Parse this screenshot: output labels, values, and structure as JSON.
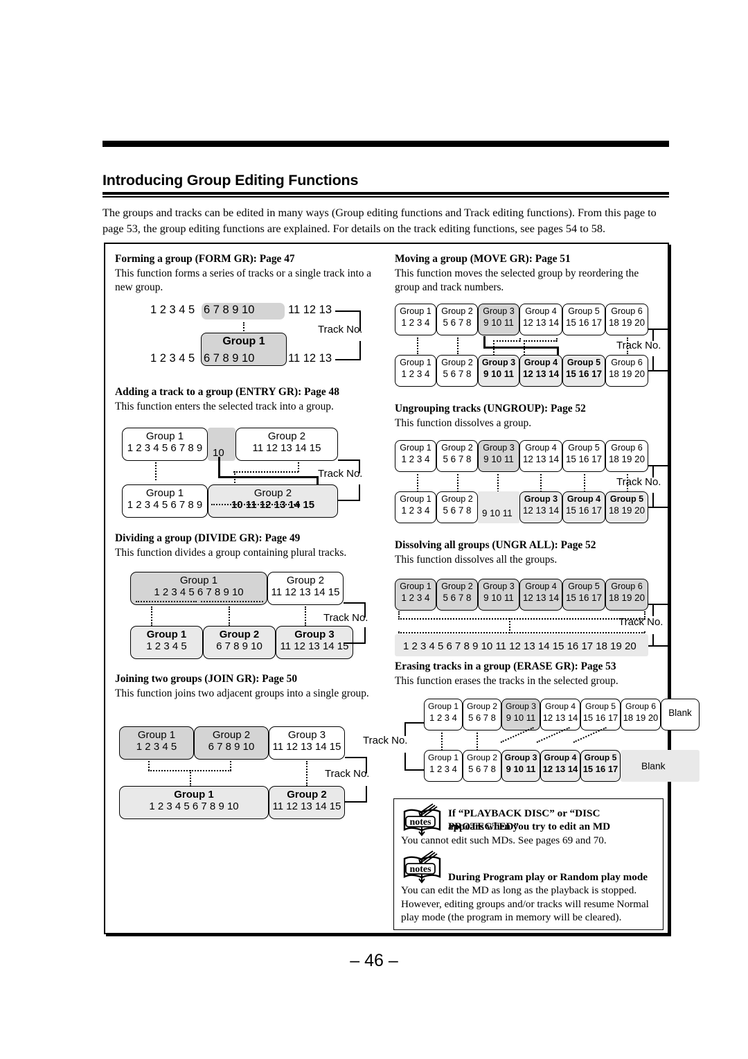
{
  "header": {
    "title": "Introducing Group Editing Functions",
    "intro": "The groups and tracks can be edited in many ways (Group editing functions and Track editing functions). From this page to page 53, the group editing functions are explained. For details on the track editing functions, see pages 54 to 58."
  },
  "labels": {
    "track_no": "Track No.",
    "blank": "Blank"
  },
  "sections": {
    "form": {
      "title": "Forming a group (FORM GR): Page 47",
      "body": "This function forms a series of tracks or a single track into a new group.",
      "before_prefix": "1 2 3 4 5",
      "before_selected": "6 7 8 9 10",
      "before_suffix": "11 12 13",
      "group_label": "Group 1",
      "after_prefix": "1 2 3 4 5",
      "after_group": "6 7 8 9 10",
      "after_suffix": "11 12 13"
    },
    "entry": {
      "title": "Adding a track to a group (ENTRY GR): Page 48",
      "body": "This function enters the selected track into a group.",
      "top": {
        "g1_name": "Group 1",
        "g1_nums": "1 2 3 4 5 6 7 8 9",
        "loose": "10",
        "g2_name": "Group 2",
        "g2_nums": "11  12  13  14  15"
      },
      "bottom": {
        "g1_name": "Group 1",
        "g1_nums": "1 2 3 4 5 6 7 8 9",
        "g2_name": "Group 2",
        "g2_nums": "10  11  12  13  14  15"
      }
    },
    "divide": {
      "title": "Dividing a group (DIVIDE GR): Page 49",
      "body": "This function divides a group containing plural tracks.",
      "top": {
        "g1_name": "Group 1",
        "g1_nums": "1  2  3  4  5  6  7  8  9  10",
        "g2_name": "Group 2",
        "g2_nums": "11 12 13 14 15"
      },
      "bottom": [
        {
          "name": "Group 1",
          "nums": "1  2  3  4  5"
        },
        {
          "name": "Group 2",
          "nums": "6  7  8  9  10"
        },
        {
          "name": "Group 3",
          "nums": "11 12 13 14 15"
        }
      ]
    },
    "join": {
      "title": "Joining two groups (JOIN GR): Page 50",
      "body": "This function joins two adjacent groups into a single group.",
      "top": [
        {
          "name": "Group 1",
          "nums": "1 2 3 4 5"
        },
        {
          "name": "Group 2",
          "nums": "6 7 8 9 10"
        },
        {
          "name": "Group 3",
          "nums": "11 12 13 14 15"
        }
      ],
      "bottom": [
        {
          "name": "Group 1",
          "nums": "1 2 3 4 5 6 7 8 9 10"
        },
        {
          "name": "Group 2",
          "nums": "11 12 13 14 15"
        }
      ]
    },
    "move": {
      "title": "Moving a group (MOVE GR): Page 51",
      "body": "This function moves the selected group by reordering the group and track numbers.",
      "top": [
        {
          "name": "Group 1",
          "nums": "1 2 3 4"
        },
        {
          "name": "Group 2",
          "nums": "5 6 7 8"
        },
        {
          "name": "Group 3",
          "nums": "9 10 11"
        },
        {
          "name": "Group 4",
          "nums": "12 13 14"
        },
        {
          "name": "Group 5",
          "nums": "15 16 17"
        },
        {
          "name": "Group 6",
          "nums": "18 19 20"
        }
      ],
      "bottom": [
        {
          "name": "Group 1",
          "nums": "1 2 3 4"
        },
        {
          "name": "Group 2",
          "nums": "5 6 7 8"
        },
        {
          "name": "Group 3",
          "nums": "9 10 11"
        },
        {
          "name": "Group 4",
          "nums": "12 13 14"
        },
        {
          "name": "Group 5",
          "nums": "15 16 17"
        },
        {
          "name": "Group 6",
          "nums": "18 19 20"
        }
      ]
    },
    "ungroup": {
      "title": "Ungrouping tracks (UNGROUP): Page 52",
      "body": "This function dissolves a group.",
      "top": [
        {
          "name": "Group 1",
          "nums": "1 2 3 4"
        },
        {
          "name": "Group 2",
          "nums": "5 6 7 8"
        },
        {
          "name": "Group 3",
          "nums": "9 10 11"
        },
        {
          "name": "Group 4",
          "nums": "12 13 14"
        },
        {
          "name": "Group 5",
          "nums": "15 16 17"
        },
        {
          "name": "Group 6",
          "nums": "18 19 20"
        }
      ],
      "bottom": [
        {
          "name": "Group 1",
          "nums": "1 2 3 4"
        },
        {
          "name": "Group 2",
          "nums": "5 6 7 8"
        },
        {
          "name": "",
          "nums": "9 10 11"
        },
        {
          "name": "Group 3",
          "nums": "12 13 14"
        },
        {
          "name": "Group 4",
          "nums": "15 16 17"
        },
        {
          "name": "Group 5",
          "nums": "18 19 20"
        }
      ]
    },
    "ungr_all": {
      "title": "Dissolving all groups (UNGR ALL): Page 52",
      "body": "This function dissolves all the groups.",
      "top": [
        {
          "name": "Group 1",
          "nums": "1 2 3 4"
        },
        {
          "name": "Group 2",
          "nums": "5 6 7 8"
        },
        {
          "name": "Group 3",
          "nums": "9 10 11"
        },
        {
          "name": "Group 4",
          "nums": "12 13 14"
        },
        {
          "name": "Group 5",
          "nums": "15 16 17"
        },
        {
          "name": "Group 6",
          "nums": "18 19 20"
        }
      ],
      "bottom_nums": "1 2 3 4 5 6 7 8 9 10 11 12 13 14 15 16 17 18 19 20"
    },
    "erase": {
      "title": "Erasing tracks in a group (ERASE GR): Page 53",
      "body": "This function erases the tracks in the selected group.",
      "top": [
        {
          "name": "Group 1",
          "nums": "1 2 3 4"
        },
        {
          "name": "Group 2",
          "nums": "5 6 7 8"
        },
        {
          "name": "Group 3",
          "nums": "9 10 11"
        },
        {
          "name": "Group 4",
          "nums": "12 13 14"
        },
        {
          "name": "Group 5",
          "nums": "15 16 17"
        },
        {
          "name": "Group 6",
          "nums": "18 19 20"
        }
      ],
      "top_blank": "Blank",
      "bottom": [
        {
          "name": "Group 1",
          "nums": "1 2 3 4"
        },
        {
          "name": "Group 2",
          "nums": "5 6 7 8"
        },
        {
          "name": "Group 3",
          "nums": "9 10 11"
        },
        {
          "name": "Group 4",
          "nums": "12 13 14"
        },
        {
          "name": "Group 5",
          "nums": "15 16 17"
        }
      ],
      "bottom_blank": "Blank"
    }
  },
  "notes": [
    {
      "icon": "notes-icon",
      "icon_word": "notes",
      "heading_line1": "If “PLAYBACK DISC” or “DISC PROTECTED”",
      "heading_line2": "appears when you try to edit an MD",
      "body": "You cannot edit such MDs. See pages 69 and 70."
    },
    {
      "icon": "notes-icon",
      "icon_word": "notes",
      "heading_line1": "During Program play or Random play mode",
      "heading_line2": "",
      "body": "You can edit the MD as long as the playback is stopped. However, editing groups and/or tracks will resume Normal play mode (the program in memory will be cleared)."
    }
  ],
  "footer": {
    "page_number": "– 46 –"
  }
}
